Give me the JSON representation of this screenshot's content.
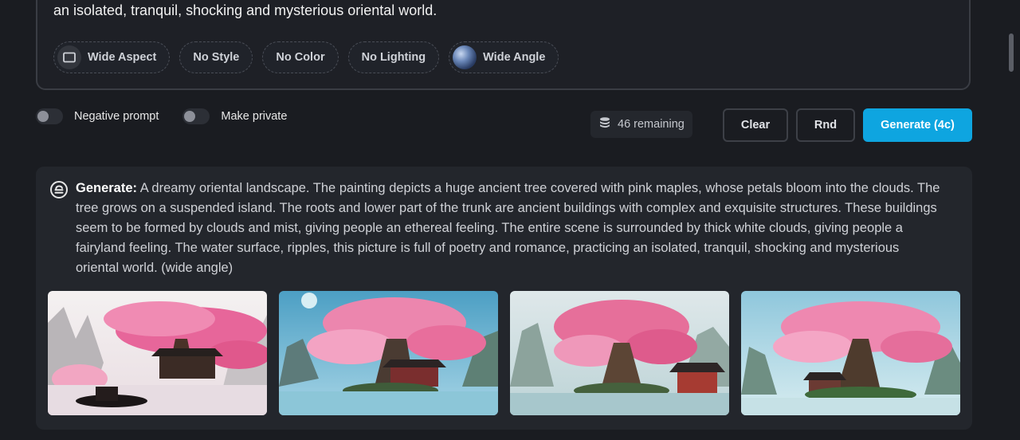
{
  "prompt": {
    "text_tail": "an isolated, tranquil, shocking and mysterious oriental world."
  },
  "chips": [
    {
      "label": "Wide Aspect",
      "icon": "aspect-ratio-icon"
    },
    {
      "label": "No Style"
    },
    {
      "label": "No Color"
    },
    {
      "label": "No Lighting"
    },
    {
      "label": "Wide Angle",
      "icon": "wide-angle-thumbnail"
    }
  ],
  "toggles": {
    "negative_prompt": "Negative prompt",
    "make_private": "Make private"
  },
  "credits": {
    "remaining": "46 remaining",
    "icon": "database-stack-icon"
  },
  "buttons": {
    "clear": "Clear",
    "rnd": "Rnd",
    "generate": "Generate (4c)"
  },
  "result": {
    "label": "Generate:",
    "prompt": "A dreamy oriental landscape. The painting depicts a huge ancient tree covered with pink maples, whose petals bloom into the clouds. The tree grows on a suspended island. The roots and lower part of the trunk are ancient buildings with complex and exquisite structures. These buildings seem to be formed by clouds and mist, giving people an ethereal feeling. The entire scene is surrounded by thick white clouds, giving people a fairyland feeling. The water surface, ripples, this picture is full of poetry and romance, practicing an isolated, tranquil, shocking and mysterious oriental world. (wide angle)",
    "icon": "generate-icon"
  },
  "colors": {
    "accent": "#0ea5e0",
    "background": "#1a1c21",
    "card": "#23262c"
  }
}
